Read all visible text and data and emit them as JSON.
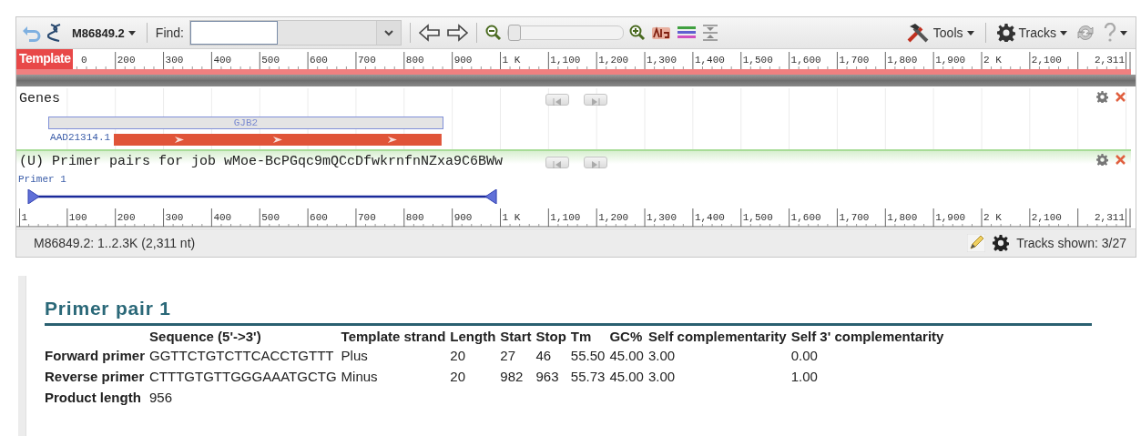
{
  "toolbar": {
    "sequence_menu": "M86849.2",
    "find_label": "Find:",
    "zoom_slider": {
      "level": 0
    },
    "tools_menu": "Tools",
    "tracks_menu": "Tracks"
  },
  "ruler_top": {
    "badge": "Template",
    "labels": [
      "0",
      "200",
      "300",
      "400",
      "500",
      "600",
      "700",
      "800",
      "900",
      "1 K",
      "1,100",
      "1,200",
      "1,300",
      "1,400",
      "1,500",
      "1,600",
      "1,700",
      "1,800",
      "1,900",
      "2 K",
      "2,100",
      "2,311"
    ]
  },
  "tracks": [
    {
      "title": "Genes",
      "selected": false,
      "features": [
        {
          "kind": "gene",
          "label": "GJB2"
        },
        {
          "kind": "cds",
          "label": "AAD21314.1"
        }
      ]
    },
    {
      "title": "(U) Primer pairs for job wMoe-BcPGqc9mQCcDfwkrnfnNZxa9C6BWw",
      "selected": true,
      "features": [
        {
          "kind": "primer",
          "label": "Primer 1"
        }
      ]
    }
  ],
  "ruler_bottom": {
    "labels": [
      "1",
      "100",
      "200",
      "300",
      "400",
      "500",
      "600",
      "700",
      "800",
      "900",
      "1 K",
      "1,100",
      "1,200",
      "1,300",
      "1,400",
      "1,500",
      "1,600",
      "1,700",
      "1,800",
      "1,900",
      "2 K",
      "2,100",
      "2,311"
    ]
  },
  "status_bar": {
    "location": "M86849.2: 1..2.3K (2,311 nt)",
    "tracks_shown": "Tracks shown: 3/27"
  },
  "result": {
    "title": "Primer pair 1",
    "columns": [
      "Sequence (5'->3')",
      "Template strand",
      "Length",
      "Start",
      "Stop",
      "Tm",
      "GC%",
      "Self complementarity",
      "Self 3' complementarity"
    ],
    "rows": [
      {
        "label": "Forward primer",
        "cells": [
          "GGTTCTGTCTTCACCTGTTT",
          "Plus",
          "20",
          "27",
          "46",
          "55.50",
          "45.00",
          "3.00",
          "0.00"
        ]
      },
      {
        "label": "Reverse primer",
        "cells": [
          "CTTTGTGTTGGGAAATGCTG",
          "Minus",
          "20",
          "982",
          "963",
          "55.73",
          "45.00",
          "3.00",
          "1.00"
        ]
      },
      {
        "label": "Product length",
        "cells": [
          "956"
        ]
      }
    ]
  }
}
